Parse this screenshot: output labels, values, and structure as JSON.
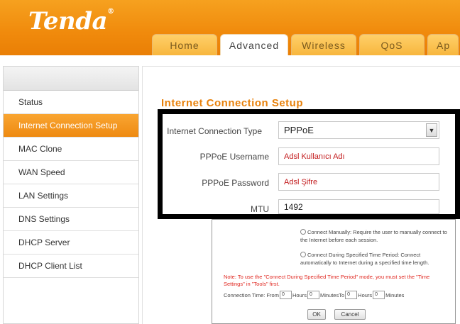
{
  "brand": {
    "logo_text": "Tenda",
    "logo_mark": "®"
  },
  "colors": {
    "brand_orange": "#f08a0c",
    "title_orange": "#e8810b",
    "note_red": "#e0261f"
  },
  "tabs": [
    {
      "label": "Home",
      "active": false
    },
    {
      "label": "Advanced",
      "active": true
    },
    {
      "label": "Wireless",
      "active": false
    },
    {
      "label": "QoS",
      "active": false
    },
    {
      "label": "Ap",
      "active": false
    }
  ],
  "sidebar": {
    "items": [
      {
        "label": "Status"
      },
      {
        "label": "Internet Connection Setup",
        "active": true
      },
      {
        "label": "MAC Clone"
      },
      {
        "label": "WAN Speed"
      },
      {
        "label": "LAN Settings"
      },
      {
        "label": "DNS Settings"
      },
      {
        "label": "DHCP Server"
      },
      {
        "label": "DHCP Client List"
      }
    ]
  },
  "main": {
    "title": "Internet Connection Setup",
    "connection_type": {
      "label": "Internet Connection Type",
      "value": "PPPoE",
      "arrow_icon": "chevron-down-icon"
    },
    "username": {
      "label": "PPPoE Username",
      "value": "Adsl Kullanıcı Adı"
    },
    "password": {
      "label": "PPPoE Password",
      "value": "Adsl Şifre"
    },
    "mtu": {
      "label": "MTU",
      "value": "1492"
    }
  },
  "panel": {
    "radio_manual": "Connect Manually: Require the user to manually connect to the Internet before each session.",
    "radio_scheduled": "Connect During Specified Time Period: Connect automatically to Internet during a specified time length.",
    "note": "Note: To use the \"Connect During Specified Time Period\" mode, you must set the \"Time Settings\" in \"Tools\" first.",
    "conn_time_label": "Connection Time: From",
    "from_hours": "0",
    "hours_label": "Hours",
    "from_minutes": "0",
    "minutes_to_label": "MinutesTo",
    "to_hours": "0",
    "hours_label_2": "Hours",
    "to_minutes": "0",
    "minutes_label": "Minutes",
    "ok_label": "OK",
    "cancel_label": "Cancel"
  }
}
